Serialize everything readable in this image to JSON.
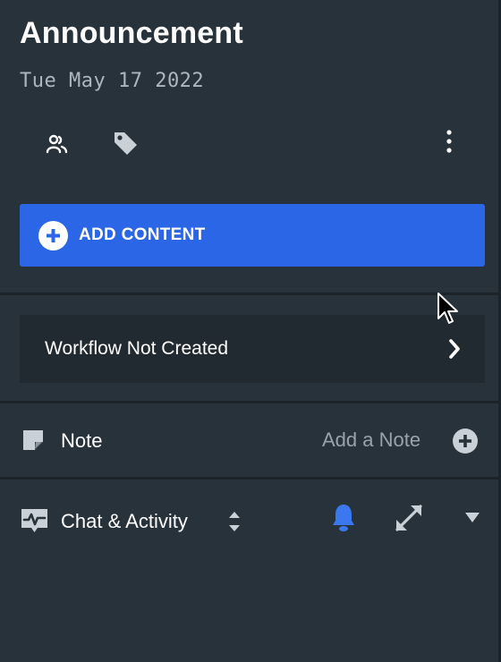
{
  "header": {
    "title": "Announcement",
    "date": "Tue May 17 2022"
  },
  "toolbar": {
    "icons": [
      "people-icon",
      "tag-icon",
      "more-vertical-icon"
    ]
  },
  "add_content": {
    "label": "ADD CONTENT",
    "icon": "plus-circle-icon"
  },
  "workflow": {
    "label": "Workflow Not Created",
    "icon": "chevron-right-icon"
  },
  "note": {
    "label": "Note",
    "action_label": "Add a Note",
    "icon": "note-icon",
    "action_icon": "plus-circle-icon"
  },
  "chat": {
    "label": "Chat & Activity",
    "icons": [
      "activity-icon",
      "sort-icon",
      "bell-icon",
      "expand-icon",
      "caret-down-icon"
    ]
  },
  "colors": {
    "background": "#28323b",
    "accent": "#2a66e6",
    "bell": "#3b78f0",
    "muted_text": "#9aa3ab"
  }
}
